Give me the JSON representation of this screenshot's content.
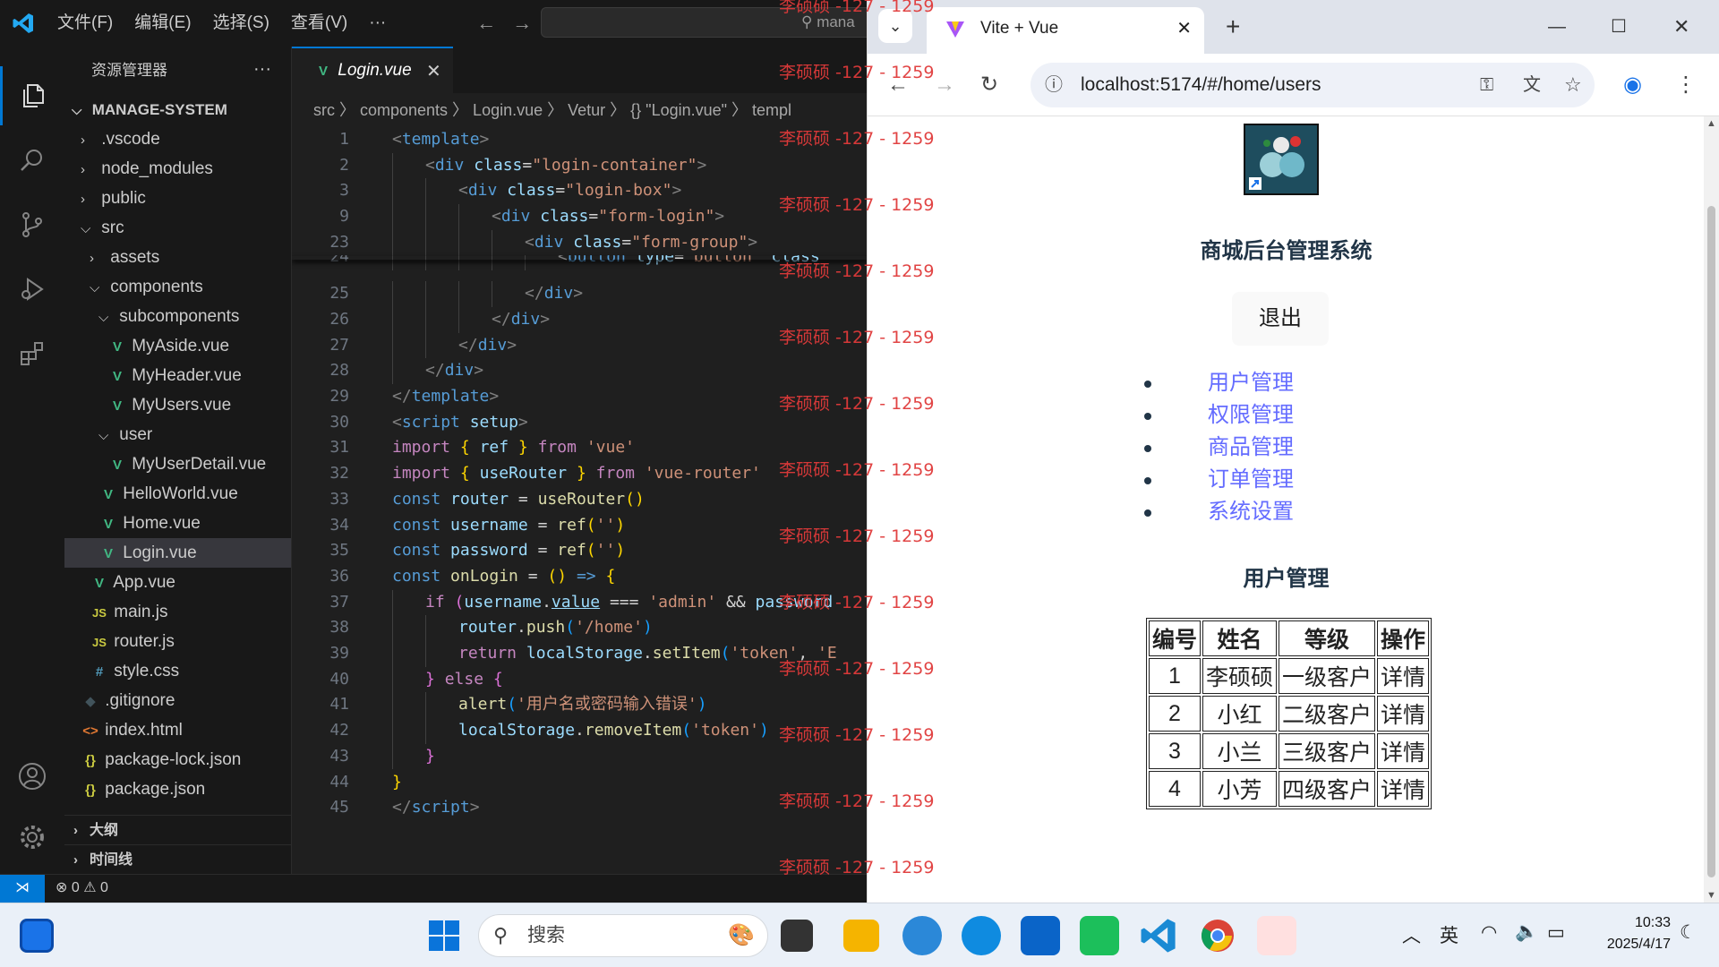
{
  "vscode": {
    "menu": [
      "文件(F)",
      "编辑(E)",
      "选择(S)",
      "查看(V)",
      "···"
    ],
    "search_text": "mana",
    "explorer_title": "资源管理器",
    "explorer_more": "···",
    "project_name": "MANAGE-SYSTEM",
    "tree": [
      {
        "label": ".vscode",
        "type": "folder",
        "depth": 1,
        "open": false
      },
      {
        "label": "node_modules",
        "type": "folder",
        "depth": 1,
        "open": false
      },
      {
        "label": "public",
        "type": "folder",
        "depth": 1,
        "open": false
      },
      {
        "label": "src",
        "type": "folder",
        "depth": 1,
        "open": true
      },
      {
        "label": "assets",
        "type": "folder",
        "depth": 2,
        "open": false
      },
      {
        "label": "components",
        "type": "folder",
        "depth": 2,
        "open": true
      },
      {
        "label": "subcomponents",
        "type": "folder",
        "depth": 3,
        "open": true
      },
      {
        "label": "MyAside.vue",
        "type": "vue",
        "depth": 4
      },
      {
        "label": "MyHeader.vue",
        "type": "vue",
        "depth": 4
      },
      {
        "label": "MyUsers.vue",
        "type": "vue",
        "depth": 4
      },
      {
        "label": "user",
        "type": "folder",
        "depth": 3,
        "open": true
      },
      {
        "label": "MyUserDetail.vue",
        "type": "vue",
        "depth": 4
      },
      {
        "label": "HelloWorld.vue",
        "type": "vue",
        "depth": 3
      },
      {
        "label": "Home.vue",
        "type": "vue",
        "depth": 3
      },
      {
        "label": "Login.vue",
        "type": "vue",
        "depth": 3,
        "selected": true
      },
      {
        "label": "App.vue",
        "type": "vue",
        "depth": 2
      },
      {
        "label": "main.js",
        "type": "js",
        "depth": 2
      },
      {
        "label": "router.js",
        "type": "js",
        "depth": 2
      },
      {
        "label": "style.css",
        "type": "css",
        "depth": 2
      },
      {
        "label": ".gitignore",
        "type": "git",
        "depth": 1
      },
      {
        "label": "index.html",
        "type": "html",
        "depth": 1
      },
      {
        "label": "package-lock.json",
        "type": "json",
        "depth": 1
      },
      {
        "label": "package.json",
        "type": "json",
        "depth": 1
      }
    ],
    "outline_label": "大纲",
    "timeline_label": "时间线",
    "tab_label": "Login.vue",
    "tab_close": "✕",
    "breadcrumb": "src 〉 components 〉 Login.vue 〉 Vetur 〉 {} \"Login.vue\" 〉 templ",
    "status_errors": "0",
    "status_warnings": "0",
    "watermark": "李硕硕 -127 - 1259",
    "code_lines": [
      {
        "n": "1",
        "indent": 0,
        "html": "<span class='t-tag'>&lt;</span><span class='t-name'>template</span><span class='t-tag'>&gt;</span>"
      },
      {
        "n": "2",
        "indent": 1,
        "html": "<span class='t-tag'>&lt;</span><span class='t-name'>div</span> <span class='t-attr'>class</span><span class='t-p'>=</span><span class='t-str'>\"login-container\"</span><span class='t-tag'>&gt;</span>"
      },
      {
        "n": "3",
        "indent": 2,
        "html": "<span class='t-tag'>&lt;</span><span class='t-name'>div</span> <span class='t-attr'>class</span><span class='t-p'>=</span><span class='t-str'>\"login-box\"</span><span class='t-tag'>&gt;</span>"
      },
      {
        "n": "9",
        "indent": 3,
        "html": "<span class='t-tag'>&lt;</span><span class='t-name'>div</span> <span class='t-attr'>class</span><span class='t-p'>=</span><span class='t-str'>\"form-login\"</span><span class='t-tag'>&gt;</span>"
      },
      {
        "n": "23",
        "indent": 4,
        "html": "<span class='t-tag'>&lt;</span><span class='t-name'>div</span> <span class='t-attr'>class</span><span class='t-p'>=</span><span class='t-str'>\"form-group\"</span><span class='t-tag'>&gt;</span>"
      },
      {
        "n": "24",
        "indent": 5,
        "html": "<span class='t-tag'>&lt;</span><span class='t-name'>button</span> <span class='t-attr'>type</span><span class='t-p'>=</span><span class='t-str'>\"button\"</span> <span class='t-attr'>class</span>"
      },
      {
        "n": "25",
        "indent": 4,
        "html": "<span class='t-tag'>&lt;/</span><span class='t-name'>div</span><span class='t-tag'>&gt;</span>"
      },
      {
        "n": "26",
        "indent": 3,
        "html": "<span class='t-tag'>&lt;/</span><span class='t-name'>div</span><span class='t-tag'>&gt;</span>"
      },
      {
        "n": "27",
        "indent": 2,
        "html": "<span class='t-tag'>&lt;/</span><span class='t-name'>div</span><span class='t-tag'>&gt;</span>"
      },
      {
        "n": "28",
        "indent": 1,
        "html": "<span class='t-tag'>&lt;/</span><span class='t-name'>div</span><span class='t-tag'>&gt;</span>"
      },
      {
        "n": "29",
        "indent": 0,
        "html": "<span class='t-tag'>&lt;/</span><span class='t-name'>template</span><span class='t-tag'>&gt;</span>"
      },
      {
        "n": "30",
        "indent": 0,
        "html": "<span class='t-tag'>&lt;</span><span class='t-name'>script</span> <span class='t-attr'>setup</span><span class='t-tag'>&gt;</span>"
      },
      {
        "n": "31",
        "indent": 0,
        "html": "<span class='t-kw'>import</span> <span class='t-br1'>{</span> <span class='t-var'>ref</span> <span class='t-br1'>}</span> <span class='t-kw'>from</span> <span class='t-str'>'vue'</span>"
      },
      {
        "n": "32",
        "indent": 0,
        "html": "<span class='t-kw'>import</span> <span class='t-br1'>{</span> <span class='t-var'>useRouter</span> <span class='t-br1'>}</span> <span class='t-kw'>from</span> <span class='t-str'>'vue-router'</span>"
      },
      {
        "n": "33",
        "indent": 0,
        "html": "<span class='t-blue'>const</span> <span class='t-var'>router</span> <span class='t-p'>=</span> <span class='t-fn'>useRouter</span><span class='t-br1'>()</span>"
      },
      {
        "n": "34",
        "indent": 0,
        "html": "<span class='t-blue'>const</span> <span class='t-var'>username</span> <span class='t-p'>=</span> <span class='t-fn'>ref</span><span class='t-br1'>(</span><span class='t-str'>''</span><span class='t-br1'>)</span>"
      },
      {
        "n": "35",
        "indent": 0,
        "html": "<span class='t-blue'>const</span> <span class='t-var'>password</span> <span class='t-p'>=</span> <span class='t-fn'>ref</span><span class='t-br1'>(</span><span class='t-str'>''</span><span class='t-br1'>)</span>"
      },
      {
        "n": "36",
        "indent": 0,
        "html": "<span class='t-blue'>const</span> <span class='t-fn'>onLogin</span> <span class='t-p'>=</span> <span class='t-br1'>()</span> <span class='t-blue'>=&gt;</span> <span class='t-br1'>{</span>"
      },
      {
        "n": "37",
        "indent": 1,
        "html": "<span class='t-kw'>if</span> <span class='t-br2'>(</span><span class='t-var'>username</span><span class='t-p'>.</span><span class='t-var' style='text-decoration:underline'>value</span> <span class='t-p'>===</span> <span class='t-str'>'admin'</span> <span class='t-p'>&amp;&amp;</span> <span class='t-var'>password</span>"
      },
      {
        "n": "38",
        "indent": 2,
        "html": "<span class='t-var'>router</span><span class='t-p'>.</span><span class='t-fn'>push</span><span class='t-br3'>(</span><span class='t-str'>'/home'</span><span class='t-br3'>)</span>"
      },
      {
        "n": "39",
        "indent": 2,
        "html": "<span class='t-kw'>return</span> <span class='t-var'>localStorage</span><span class='t-p'>.</span><span class='t-fn'>setItem</span><span class='t-br3'>(</span><span class='t-str'>'token'</span><span class='t-p'>,</span> <span class='t-str'>'E</span>"
      },
      {
        "n": "40",
        "indent": 1,
        "html": "<span class='t-br2'>}</span> <span class='t-kw'>else</span> <span class='t-br2'>{</span>"
      },
      {
        "n": "41",
        "indent": 2,
        "html": "<span class='t-fn'>alert</span><span class='t-br3'>(</span><span class='t-str'>'用户名或密码输入错误'</span><span class='t-br3'>)</span>"
      },
      {
        "n": "42",
        "indent": 2,
        "html": "<span class='t-var'>localStorage</span><span class='t-p'>.</span><span class='t-fn'>removeItem</span><span class='t-br3'>(</span><span class='t-str'>'token'</span><span class='t-br3'>)</span>"
      },
      {
        "n": "43",
        "indent": 1,
        "html": "<span class='t-br2'>}</span>"
      },
      {
        "n": "44",
        "indent": 0,
        "html": "<span class='t-br1'>}</span>"
      },
      {
        "n": "45",
        "indent": 0,
        "html": "<span class='t-tag'>&lt;/</span><span class='t-name'>script</span><span class='t-tag'>&gt;</span>"
      }
    ]
  },
  "browser": {
    "tab_title": "Vite + Vue",
    "url": "localhost:5174/#/home/users",
    "page_title": "商城后台管理系统",
    "logout_label": "退出",
    "menu_items": [
      "用户管理",
      "权限管理",
      "商品管理",
      "订单管理",
      "系统设置"
    ],
    "section_title": "用户管理",
    "table_headers": [
      "编号",
      "姓名",
      "等级",
      "操作"
    ],
    "table_rows": [
      [
        "1",
        "李硕硕",
        "一级客户",
        "详情"
      ],
      [
        "2",
        "小红",
        "二级客户",
        "详情"
      ],
      [
        "3",
        "小兰",
        "三级客户",
        "详情"
      ],
      [
        "4",
        "小芳",
        "四级客户",
        "详情"
      ]
    ]
  },
  "taskbar": {
    "search_placeholder": "搜索",
    "ime_label": "英",
    "time": "10:33",
    "date": "2025/4/17"
  },
  "colors": {
    "vscode_accent": "#0078d4",
    "vue_link": "#646cff",
    "watermark": "#e03a3a"
  }
}
